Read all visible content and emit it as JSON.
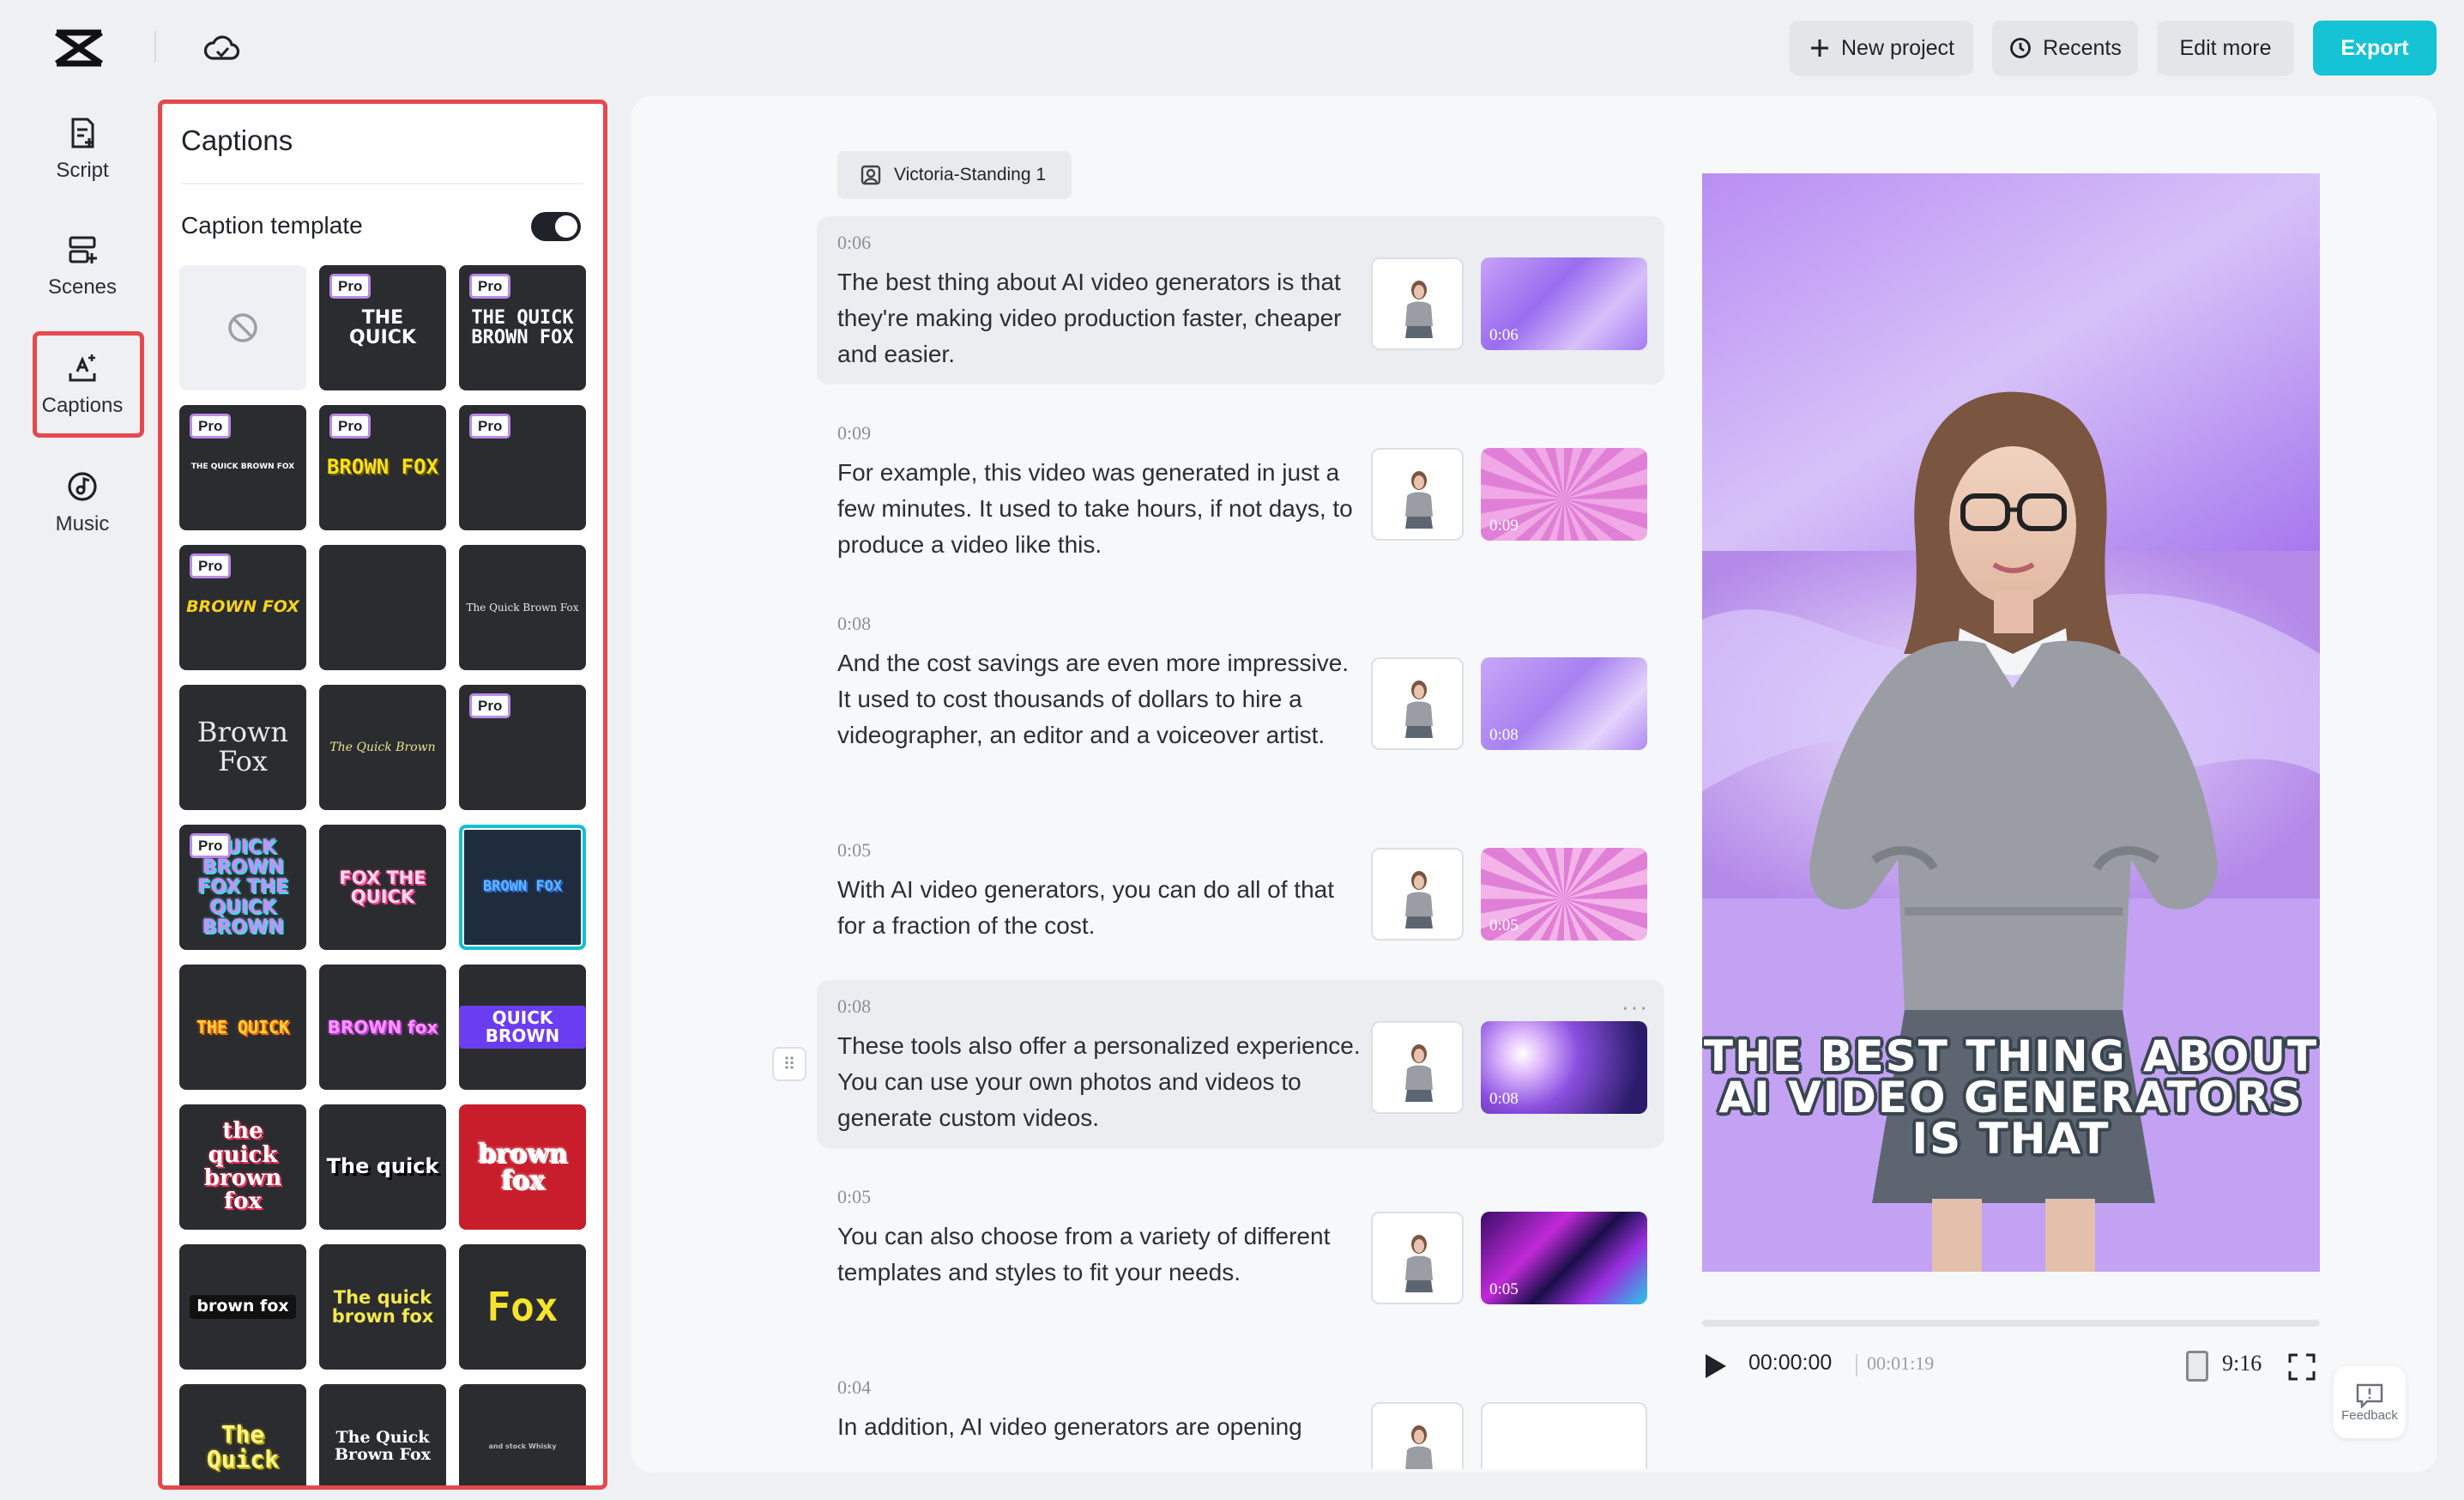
{
  "topbar": {
    "new_project": "New project",
    "recents": "Recents",
    "edit_more": "Edit more",
    "export": "Export"
  },
  "rail": {
    "items": [
      {
        "label": "Script",
        "icon": "script-icon"
      },
      {
        "label": "Scenes",
        "icon": "scenes-icon"
      },
      {
        "label": "Captions",
        "icon": "captions-icon"
      },
      {
        "label": "Music",
        "icon": "music-icon"
      }
    ]
  },
  "captions_panel": {
    "title": "Captions",
    "template_label": "Caption template",
    "toggle_on": true,
    "pro_badge": "Pro",
    "templates": [
      {
        "text": "",
        "none": true
      },
      {
        "text": "THE QUICK",
        "pro": true
      },
      {
        "text": "THE QUICK BROWN FOX",
        "pro": true
      },
      {
        "text": "THE QUICK BROWN FOX",
        "pro": true
      },
      {
        "text": "BROWN FOX",
        "pro": true
      },
      {
        "text": "",
        "pro": true
      },
      {
        "text": "BROWN FOX",
        "pro": true
      },
      {
        "text": ""
      },
      {
        "text": "The Quick Brown Fox"
      },
      {
        "text": "Brown Fox"
      },
      {
        "text": "The Quick Brown"
      },
      {
        "text": "",
        "pro": true
      },
      {
        "text": "QUICK BROWN FOX THE QUICK BROWN",
        "pro": true
      },
      {
        "text": "FOX THE QUICK"
      },
      {
        "text": "BROWN FOX",
        "selected": true
      },
      {
        "text": "THE QUICK"
      },
      {
        "text": "BROWN fox"
      },
      {
        "text": "QUICK BROWN"
      },
      {
        "text": "the quick brown fox"
      },
      {
        "text": "The quick"
      },
      {
        "text": "brown fox"
      },
      {
        "text": "brown fox"
      },
      {
        "text": "The quick brown fox"
      },
      {
        "text": "Fox"
      },
      {
        "text": "The Quick"
      },
      {
        "text": "The Quick Brown Fox"
      },
      {
        "text": "and stock Whisky"
      }
    ]
  },
  "script": {
    "avatar_chip": "Victoria-Standing 1",
    "scenes": [
      {
        "time": "0:06",
        "text": "The best thing about AI video generators is that they're making video production faster, cheaper and easier.",
        "thumb_time": "0:06"
      },
      {
        "time": "0:09",
        "text": "For example, this video was generated in just a few minutes. It used to take hours, if not days, to produce a video like this.",
        "thumb_time": "0:09"
      },
      {
        "time": "0:08",
        "text": "And the cost savings are even more impressive. It used to cost thousands of dollars to hire a videographer, an editor and a voiceover artist.",
        "thumb_time": "0:08"
      },
      {
        "time": "0:05",
        "text": "With AI video generators, you can do all of that for a fraction of the cost.",
        "thumb_time": "0:05"
      },
      {
        "time": "0:08",
        "text": "These tools also offer a personalized experience. You can use your own photos and videos to generate custom videos.",
        "thumb_time": "0:08"
      },
      {
        "time": "0:05",
        "text": "You can also choose from a variety of different templates and styles to fit your needs.",
        "thumb_time": "0:05"
      },
      {
        "time": "0:04",
        "text": "In addition, AI video generators are opening",
        "thumb_time": ""
      }
    ]
  },
  "preview": {
    "caption": "THE BEST THING ABOUT AI VIDEO GENERATORS IS THAT",
    "current_time": "00:00:00",
    "total_time": "00:01:19",
    "aspect": "9:16",
    "progress": 0
  },
  "feedback": "Feedback",
  "colors": {
    "accent": "#14c3d4",
    "highlight": "#e5484d"
  }
}
